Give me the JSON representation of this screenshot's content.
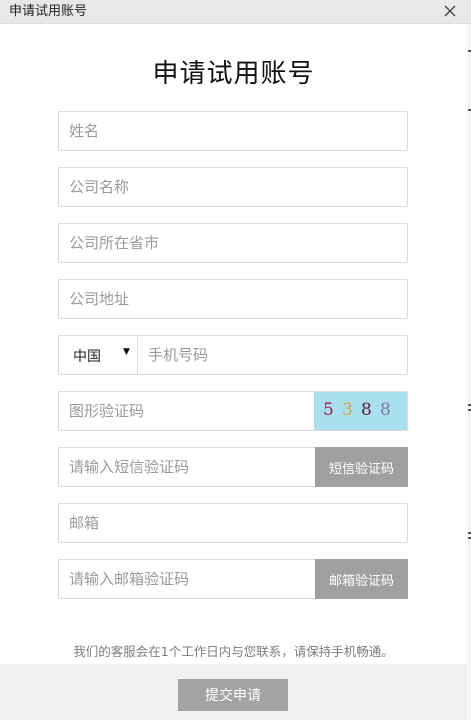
{
  "window": {
    "title": "申请试用账号",
    "close_icon": "close-icon"
  },
  "form": {
    "heading": "申请试用账号",
    "name_placeholder": "姓名",
    "company_placeholder": "公司名称",
    "province_placeholder": "公司所在省市",
    "address_placeholder": "公司地址",
    "country_selected": "中国",
    "phone_placeholder": "手机号码",
    "captcha_placeholder": "图形验证码",
    "captcha_digits": [
      {
        "char": "5",
        "color": "#9c1a4a"
      },
      {
        "char": "3",
        "color": "#d9a03a"
      },
      {
        "char": "8",
        "color": "#5a1e34"
      },
      {
        "char": "8",
        "color": "#8a6fa8"
      }
    ],
    "captcha_background": "#a9e0f0",
    "sms_code_placeholder": "请输入短信验证码",
    "sms_code_button": "短信验证码",
    "email_placeholder": "邮箱",
    "email_code_placeholder": "请输入邮箱验证码",
    "email_code_button": "邮箱验证码",
    "notice": "我们的客服会在1个工作日内与您联系，请保持手机畅通。",
    "submit_label": "提交申请"
  }
}
